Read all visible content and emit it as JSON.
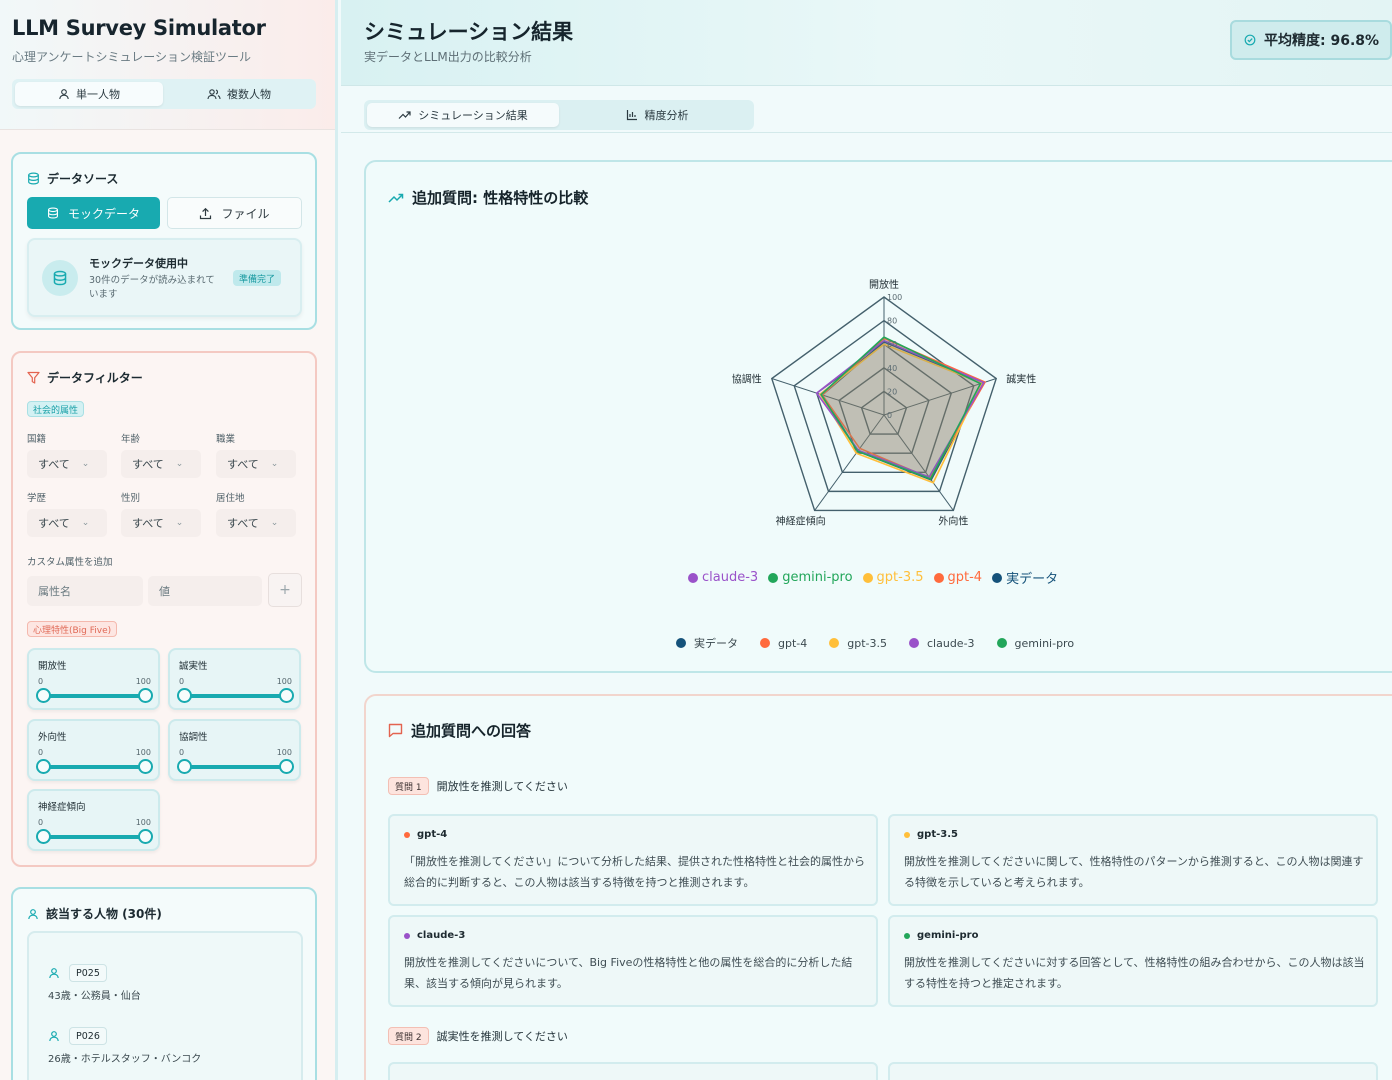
{
  "app": {
    "title": "LLM Survey Simulator",
    "subtitle": "心理アンケートシミュレーション検証ツール"
  },
  "mode_tabs": [
    {
      "label": "単一人物",
      "icon": "user-icon",
      "active": true
    },
    {
      "label": "複数人物",
      "icon": "users-icon",
      "active": false
    }
  ],
  "data_source": {
    "title": "データソース",
    "mock_button": "モックデータ",
    "file_button": "ファイル",
    "status_title": "モックデータ使用中",
    "status_desc": "30件のデータが読み込まれています",
    "status_badge": "準備完了"
  },
  "filters": {
    "title": "データフィルター",
    "social_tag": "社会的属性",
    "fields": [
      {
        "label": "国籍",
        "value": "すべて"
      },
      {
        "label": "年齢",
        "value": "すべて"
      },
      {
        "label": "職業",
        "value": "すべて"
      },
      {
        "label": "学歴",
        "value": "すべて"
      },
      {
        "label": "性別",
        "value": "すべて"
      },
      {
        "label": "居住地",
        "value": "すべて"
      }
    ],
    "custom_label": "カスタム属性を追加",
    "attr_name_placeholder": "属性名",
    "attr_value_placeholder": "値",
    "add_symbol": "+",
    "psych_tag": "心理特性(Big Five)",
    "traits": [
      {
        "name": "開放性",
        "min": "0",
        "max": "100",
        "low": 0,
        "high": 100
      },
      {
        "name": "誠実性",
        "min": "0",
        "max": "100",
        "low": 0,
        "high": 100
      },
      {
        "name": "外向性",
        "min": "0",
        "max": "100",
        "low": 0,
        "high": 100
      },
      {
        "name": "協調性",
        "min": "0",
        "max": "100",
        "low": 0,
        "high": 100
      },
      {
        "name": "神経症傾向",
        "min": "0",
        "max": "100",
        "low": 0,
        "high": 100
      }
    ]
  },
  "people": {
    "title": "該当する人物 (30件)",
    "items": [
      {
        "id": "P025",
        "desc": "43歳・公務員・仙台"
      },
      {
        "id": "P026",
        "desc": "26歳・ホテルスタッフ・バンコク"
      }
    ]
  },
  "main": {
    "title": "シミュレーション結果",
    "subtitle": "実データとLLM出力の比較分析",
    "accuracy": "平均精度: 96.8%",
    "tabs": [
      {
        "label": "シミュレーション結果",
        "active": true
      },
      {
        "label": "精度分析",
        "active": false
      }
    ]
  },
  "colors": {
    "accent": "#18aab0",
    "real": "#15527a",
    "gpt4": "#ff6a3d",
    "gpt35": "#ffbf3a",
    "claude3": "#9a52c9",
    "geminipro": "#22a65a"
  },
  "chart_card": {
    "title": "追加質問: 性格特性の比較"
  },
  "chart_data": {
    "type": "radar",
    "axes": [
      "開放性",
      "誠実性",
      "外向性",
      "神経症傾向",
      "協調性"
    ],
    "rlim": [
      0,
      100
    ],
    "ticks": [
      "0",
      "20",
      "40",
      "60",
      "80",
      "100"
    ],
    "grid": true,
    "series": [
      {
        "name": "実データ",
        "values": [
          62,
          88,
          68,
          38,
          55
        ]
      },
      {
        "name": "gpt-4",
        "values": [
          65,
          90,
          66,
          35,
          55
        ]
      },
      {
        "name": "gpt-3.5",
        "values": [
          60,
          87,
          71,
          40,
          57
        ]
      },
      {
        "name": "claude-3",
        "values": [
          63,
          89,
          65,
          37,
          60
        ]
      },
      {
        "name": "gemini-pro",
        "values": [
          66,
          86,
          67,
          38,
          56
        ]
      }
    ],
    "legend_top": [
      "claude-3",
      "gemini-pro",
      "gpt-3.5",
      "gpt-4",
      "実データ"
    ],
    "legend_bottom": [
      "実データ",
      "gpt-4",
      "gpt-3.5",
      "claude-3",
      "gemini-pro"
    ]
  },
  "answers": {
    "title": "追加質問への回答",
    "questions": [
      {
        "badge": "質問 1",
        "text": "開放性を推測してください",
        "responses": [
          {
            "model": "gpt-4",
            "text": "「開放性を推測してください」について分析した結果、提供された性格特性と社会的属性から総合的に判断すると、この人物は該当する特徴を持つと推測されます。"
          },
          {
            "model": "gpt-3.5",
            "text": "開放性を推測してくださいに関して、性格特性のパターンから推測すると、この人物は関連する特徴を示していると考えられます。"
          },
          {
            "model": "claude-3",
            "text": "開放性を推測してくださいについて、Big Fiveの性格特性と他の属性を総合的に分析した結果、該当する傾向が見られます。"
          },
          {
            "model": "gemini-pro",
            "text": "開放性を推測してくださいに対する回答として、性格特性の組み合わせから、この人物は該当する特性を持つと推定されます。"
          }
        ]
      },
      {
        "badge": "質問 2",
        "text": "誠実性を推測してください"
      }
    ]
  }
}
